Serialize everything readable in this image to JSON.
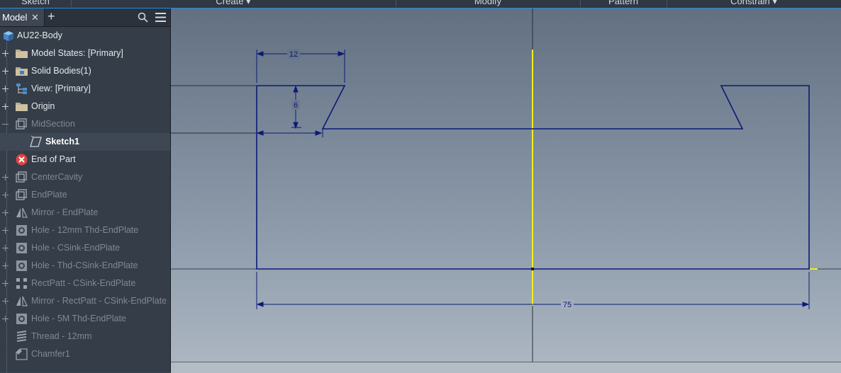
{
  "ribbon": {
    "tabs": [
      "Sketch",
      "Create ▾",
      "Modify",
      "Pattern",
      "Constrain ▾"
    ]
  },
  "browser": {
    "tab_label": "Model",
    "close_glyph": "✕",
    "add_glyph": "+",
    "search_icon": "search-icon",
    "menu_icon": "hamburger-menu-icon",
    "tree": [
      {
        "label": "AU22-Body",
        "icon": "part-icon",
        "state": "normal",
        "expander": "none"
      },
      {
        "label": "Model States: [Primary]",
        "icon": "folder-icon",
        "state": "normal",
        "expander": "plus"
      },
      {
        "label": "Solid Bodies(1)",
        "icon": "solid-bodies-icon",
        "state": "normal",
        "expander": "plus"
      },
      {
        "label": "View: [Primary]",
        "icon": "view-icon",
        "state": "normal",
        "expander": "plus"
      },
      {
        "label": "Origin",
        "icon": "folder-icon",
        "state": "normal",
        "expander": "plus"
      },
      {
        "label": "MidSection",
        "icon": "extrude-icon",
        "state": "dim",
        "expander": "minus"
      },
      {
        "label": "Sketch1",
        "icon": "sketch-icon",
        "state": "bold",
        "expander": "none"
      },
      {
        "label": "End of Part",
        "icon": "end-of-part-icon",
        "state": "normal",
        "expander": "none"
      },
      {
        "label": "CenterCavity",
        "icon": "extrude-icon",
        "state": "dim",
        "expander": "plus"
      },
      {
        "label": "EndPlate",
        "icon": "extrude-icon",
        "state": "dim",
        "expander": "plus"
      },
      {
        "label": "Mirror - EndPlate",
        "icon": "mirror-icon",
        "state": "dim",
        "expander": "plus"
      },
      {
        "label": "Hole - 12mm Thd-EndPlate",
        "icon": "hole-icon",
        "state": "dim",
        "expander": "plus"
      },
      {
        "label": "Hole - CSink-EndPlate",
        "icon": "hole-icon",
        "state": "dim",
        "expander": "plus"
      },
      {
        "label": "Hole - Thd-CSink-EndPlate",
        "icon": "hole-icon",
        "state": "dim",
        "expander": "plus"
      },
      {
        "label": "RectPatt - CSink-EndPlate",
        "icon": "rect-pattern-icon",
        "state": "dim",
        "expander": "plus"
      },
      {
        "label": "Mirror - RectPatt - CSink-EndPlate",
        "icon": "mirror-icon",
        "state": "dim",
        "expander": "plus"
      },
      {
        "label": "Hole - 5M Thd-EndPlate",
        "icon": "hole-icon",
        "state": "dim",
        "expander": "plus"
      },
      {
        "label": "Thread - 12mm",
        "icon": "thread-icon",
        "state": "dim",
        "expander": "none"
      },
      {
        "label": "Chamfer1",
        "icon": "chamfer-icon",
        "state": "dim",
        "expander": "none"
      }
    ]
  },
  "sketch": {
    "dimensions": {
      "top_width": "12",
      "height": "6",
      "total_width": "75"
    },
    "colors": {
      "geometry": "#0b1a78",
      "axis": "#f2ee1a",
      "construction": "#2a2f38"
    }
  }
}
